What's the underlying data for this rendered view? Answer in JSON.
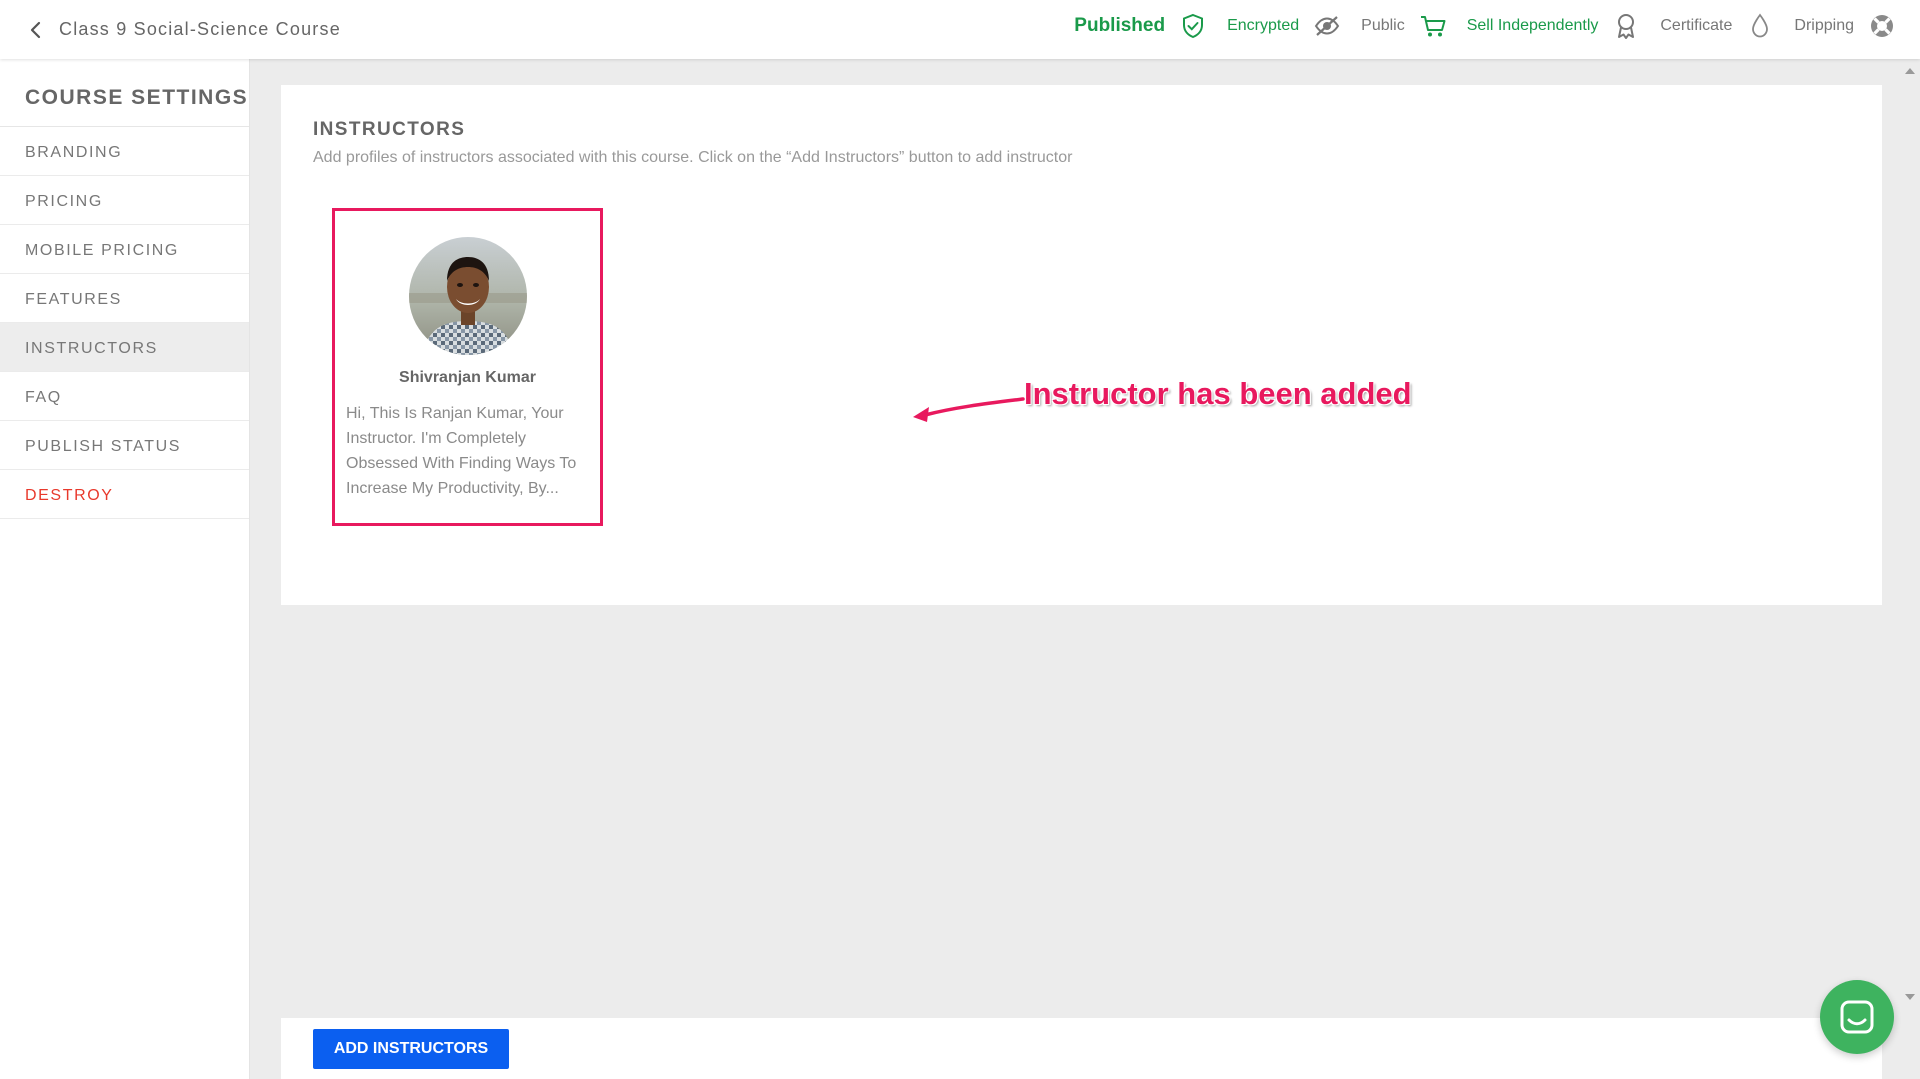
{
  "header": {
    "course_title": "Class 9 Social-Science Course",
    "status": [
      {
        "label": "Published",
        "icon": "shield-check-icon"
      },
      {
        "label": "Encrypted",
        "icon": "eye-slash-icon"
      },
      {
        "label": "Public",
        "icon": "cart-icon"
      },
      {
        "label": "Sell Independently",
        "icon": "award-ribbon-icon"
      },
      {
        "label": "Certificate",
        "icon": "drop-icon"
      },
      {
        "label": "Dripping",
        "icon": "lifebuoy-icon"
      }
    ]
  },
  "sidebar": {
    "heading": "COURSE SETTINGS",
    "items": [
      {
        "label": "BRANDING"
      },
      {
        "label": "PRICING"
      },
      {
        "label": "MOBILE PRICING"
      },
      {
        "label": "FEATURES"
      },
      {
        "label": "INSTRUCTORS",
        "active": true
      },
      {
        "label": "FAQ"
      },
      {
        "label": "PUBLISH STATUS"
      },
      {
        "label": "DESTROY",
        "danger": true
      }
    ]
  },
  "main": {
    "section_title": "INSTRUCTORS",
    "section_description": "Add profiles of instructors associated with this course. Click on the “Add Instructors” button to add instructor",
    "instructor": {
      "name": "Shivranjan Kumar",
      "bio": "Hi, This Is Ranjan Kumar, Your Instructor.  I'm Completely Obsessed With Finding Ways To Increase My Productivity, By..."
    },
    "annotation": "Instructor has been added"
  },
  "footer": {
    "add_button_label": "ADD INSTRUCTORS"
  },
  "colors": {
    "accent_blue": "#0b5ff0",
    "published_green": "#1a9a4a",
    "annotation_pink": "#e8195e",
    "danger_red": "#e8392c",
    "chat_green": "#3eb35f"
  }
}
